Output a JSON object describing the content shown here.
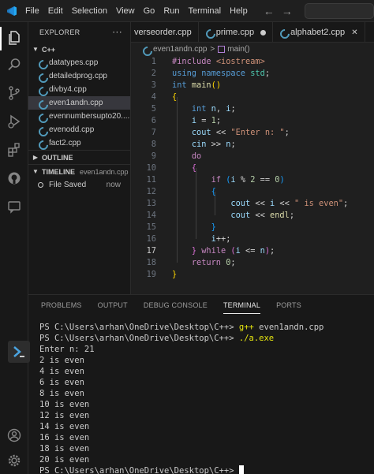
{
  "titlebar": {
    "menu": [
      "File",
      "Edit",
      "Selection",
      "View",
      "Go",
      "Run",
      "Terminal",
      "Help"
    ],
    "back_icon": "arrow-left-icon",
    "forward_icon": "arrow-right-icon"
  },
  "activitybar": {
    "icons": [
      "explorer-icon",
      "search-icon",
      "source-control-icon",
      "run-debug-icon",
      "extensions-icon",
      "github-icon",
      "remote-chat-icon",
      "account-icon",
      "settings-gear-icon"
    ]
  },
  "sidebar": {
    "header": "EXPLORER",
    "more": "···",
    "folder": "C++",
    "files": [
      "datatypes.cpp",
      "detailedprog.cpp",
      "divby4.cpp",
      "even1andn.cpp",
      "evennumbersupto20....",
      "evenodd.cpp",
      "fact2.cpp"
    ],
    "active_file_index": 3,
    "outline_label": "OUTLINE",
    "timeline_label": "TIMELINE",
    "timeline_file": "even1andn.cpp",
    "timeline_entry": "File Saved",
    "timeline_time": "now"
  },
  "tabs": [
    {
      "label": "verseorder.cpp",
      "state": "none"
    },
    {
      "label": "prime.cpp",
      "state": "modified"
    },
    {
      "label": "alphabet2.cpp",
      "state": "close"
    }
  ],
  "breadcrumb": {
    "file": "even1andn.cpp",
    "separator": ">",
    "symbol": "main()"
  },
  "editor": {
    "current_line": 17,
    "line_numbers": [
      "1",
      "2",
      "3",
      "4",
      "5",
      "6",
      "7",
      "8",
      "9",
      "10",
      "11",
      "12",
      "13",
      "14",
      "15",
      "16",
      "17",
      "18",
      "19"
    ]
  },
  "panel": {
    "tabs": [
      "PROBLEMS",
      "OUTPUT",
      "DEBUG CONSOLE",
      "TERMINAL",
      "PORTS"
    ],
    "active_tab": "TERMINAL",
    "prompt": "PS C:\\Users\\arhan\\OneDrive\\Desktop\\C++>",
    "commands": [
      {
        "cmd": "g++",
        "args": "even1andn.cpp"
      },
      {
        "cmd": "./a.exe",
        "args": ""
      }
    ],
    "output": [
      "Enter n: 21",
      "2 is even",
      "4 is even",
      "6 is even",
      "8 is even",
      "10 is even",
      "12 is even",
      "14 is even",
      "16 is even",
      "18 is even",
      "20 is even"
    ]
  },
  "colors": {
    "accent": "#ffffff",
    "keyword": "#569cd6",
    "control": "#c586c0",
    "function": "#dcdcaa",
    "string": "#ce9178",
    "number": "#b5cea8",
    "variable": "#9cdcfe",
    "terminal_command": "#e5e510"
  }
}
